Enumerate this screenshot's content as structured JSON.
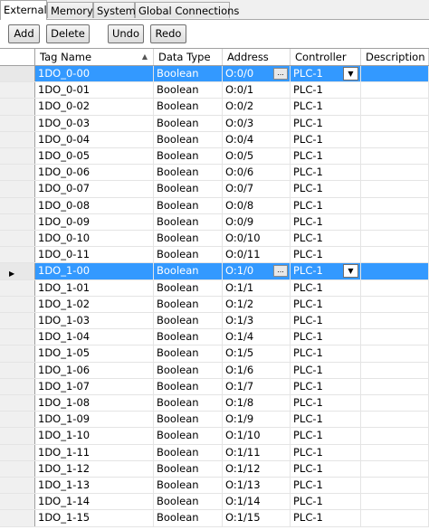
{
  "tabs": [
    {
      "label": "External",
      "active": true
    },
    {
      "label": "Memory",
      "active": false
    },
    {
      "label": "System",
      "active": false
    },
    {
      "label": "Global Connections",
      "active": false
    }
  ],
  "toolbar": {
    "add_label": "Add",
    "delete_label": "Delete",
    "undo_label": "Undo",
    "redo_label": "Redo"
  },
  "columns": {
    "tag_name": "Tag Name",
    "data_type": "Data Type",
    "address": "Address",
    "controller": "Controller",
    "description": "Description"
  },
  "icons": {
    "sort": "sort-ascending-icon",
    "row_indicator": "row-pointer-icon",
    "ellipsis": "ellipsis-icon",
    "dropdown": "chevron-down-icon"
  },
  "colors": {
    "selection": "#3399ff",
    "header_bg": "#f0f0f0"
  },
  "rows": [
    {
      "tag": "1DO_0-00",
      "type": "Boolean",
      "address": "O:0/0",
      "controller": "PLC-1",
      "description": "",
      "selected": true,
      "current": false
    },
    {
      "tag": "1DO_0-01",
      "type": "Boolean",
      "address": "O:0/1",
      "controller": "PLC-1",
      "description": ""
    },
    {
      "tag": "1DO_0-02",
      "type": "Boolean",
      "address": "O:0/2",
      "controller": "PLC-1",
      "description": ""
    },
    {
      "tag": "1DO_0-03",
      "type": "Boolean",
      "address": "O:0/3",
      "controller": "PLC-1",
      "description": ""
    },
    {
      "tag": "1DO_0-04",
      "type": "Boolean",
      "address": "O:0/4",
      "controller": "PLC-1",
      "description": ""
    },
    {
      "tag": "1DO_0-05",
      "type": "Boolean",
      "address": "O:0/5",
      "controller": "PLC-1",
      "description": ""
    },
    {
      "tag": "1DO_0-06",
      "type": "Boolean",
      "address": "O:0/6",
      "controller": "PLC-1",
      "description": ""
    },
    {
      "tag": "1DO_0-07",
      "type": "Boolean",
      "address": "O:0/7",
      "controller": "PLC-1",
      "description": ""
    },
    {
      "tag": "1DO_0-08",
      "type": "Boolean",
      "address": "O:0/8",
      "controller": "PLC-1",
      "description": ""
    },
    {
      "tag": "1DO_0-09",
      "type": "Boolean",
      "address": "O:0/9",
      "controller": "PLC-1",
      "description": ""
    },
    {
      "tag": "1DO_0-10",
      "type": "Boolean",
      "address": "O:0/10",
      "controller": "PLC-1",
      "description": ""
    },
    {
      "tag": "1DO_0-11",
      "type": "Boolean",
      "address": "O:0/11",
      "controller": "PLC-1",
      "description": ""
    },
    {
      "tag": "1DO_1-00",
      "type": "Boolean",
      "address": "O:1/0",
      "controller": "PLC-1",
      "description": "",
      "selected": true,
      "current": true
    },
    {
      "tag": "1DO_1-01",
      "type": "Boolean",
      "address": "O:1/1",
      "controller": "PLC-1",
      "description": ""
    },
    {
      "tag": "1DO_1-02",
      "type": "Boolean",
      "address": "O:1/2",
      "controller": "PLC-1",
      "description": ""
    },
    {
      "tag": "1DO_1-03",
      "type": "Boolean",
      "address": "O:1/3",
      "controller": "PLC-1",
      "description": ""
    },
    {
      "tag": "1DO_1-04",
      "type": "Boolean",
      "address": "O:1/4",
      "controller": "PLC-1",
      "description": ""
    },
    {
      "tag": "1DO_1-05",
      "type": "Boolean",
      "address": "O:1/5",
      "controller": "PLC-1",
      "description": ""
    },
    {
      "tag": "1DO_1-06",
      "type": "Boolean",
      "address": "O:1/6",
      "controller": "PLC-1",
      "description": ""
    },
    {
      "tag": "1DO_1-07",
      "type": "Boolean",
      "address": "O:1/7",
      "controller": "PLC-1",
      "description": ""
    },
    {
      "tag": "1DO_1-08",
      "type": "Boolean",
      "address": "O:1/8",
      "controller": "PLC-1",
      "description": ""
    },
    {
      "tag": "1DO_1-09",
      "type": "Boolean",
      "address": "O:1/9",
      "controller": "PLC-1",
      "description": ""
    },
    {
      "tag": "1DO_1-10",
      "type": "Boolean",
      "address": "O:1/10",
      "controller": "PLC-1",
      "description": ""
    },
    {
      "tag": "1DO_1-11",
      "type": "Boolean",
      "address": "O:1/11",
      "controller": "PLC-1",
      "description": ""
    },
    {
      "tag": "1DO_1-12",
      "type": "Boolean",
      "address": "O:1/12",
      "controller": "PLC-1",
      "description": ""
    },
    {
      "tag": "1DO_1-13",
      "type": "Boolean",
      "address": "O:1/13",
      "controller": "PLC-1",
      "description": ""
    },
    {
      "tag": "1DO_1-14",
      "type": "Boolean",
      "address": "O:1/14",
      "controller": "PLC-1",
      "description": ""
    },
    {
      "tag": "1DO_1-15",
      "type": "Boolean",
      "address": "O:1/15",
      "controller": "PLC-1",
      "description": ""
    }
  ]
}
